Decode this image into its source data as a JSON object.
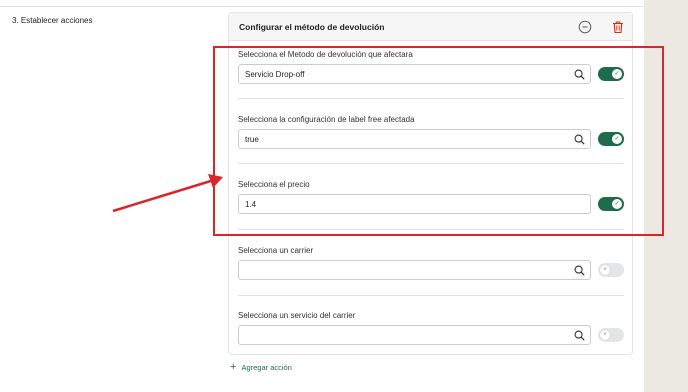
{
  "step": {
    "label": "3. Establecer acciones"
  },
  "card": {
    "title": "Configurar el método de devolución",
    "icons": {
      "collapse": "minus-circle-icon",
      "delete": "trash-icon"
    }
  },
  "fields": [
    {
      "label": "Selecciona el Metodo de devolución que afectara",
      "value": "Servicio Drop-off",
      "toggle": "on"
    },
    {
      "label": "Selecciona la configuración de label free afectada",
      "value": "true",
      "toggle": "on"
    },
    {
      "label": "Selecciona el precio",
      "value": "1.4",
      "toggle": "on"
    },
    {
      "label": "Selecciona un carrier",
      "value": "",
      "toggle": "off"
    },
    {
      "label": "Selecciona un servicio del carrier",
      "value": "",
      "toggle": "off"
    }
  ],
  "add_action": {
    "label": "Agregar acción"
  },
  "colors": {
    "accent": "#1e6b4d",
    "annotation": "#d9262b",
    "danger": "#d72c0d"
  }
}
